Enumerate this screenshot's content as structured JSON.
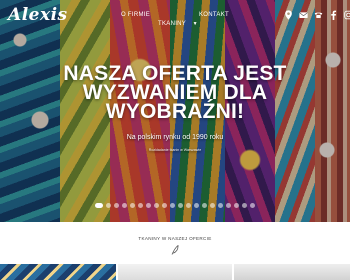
{
  "brand": {
    "logo_text": "Alexis"
  },
  "nav": {
    "items": [
      {
        "label": "O FIRMIE"
      },
      {
        "label": "TKANINY"
      },
      {
        "label": "KONTAKT"
      }
    ],
    "icons": [
      "location-pin-icon",
      "mail-icon",
      "phone-icon",
      "facebook-icon",
      "instagram-icon"
    ]
  },
  "hero": {
    "headline_line1": "NASZA OFERTA JEST",
    "headline_line2": "WYZWANIEM DLA",
    "headline_line3": "WYOBRAŹNI!",
    "subline": "Na polskim rynku od 1990 roku",
    "caption": "Rozkładanie tkanin w Warszawie",
    "slider_total": 20,
    "slider_active": 1
  },
  "section": {
    "title": "TKANINY W NASZEJ OFERCIE"
  }
}
